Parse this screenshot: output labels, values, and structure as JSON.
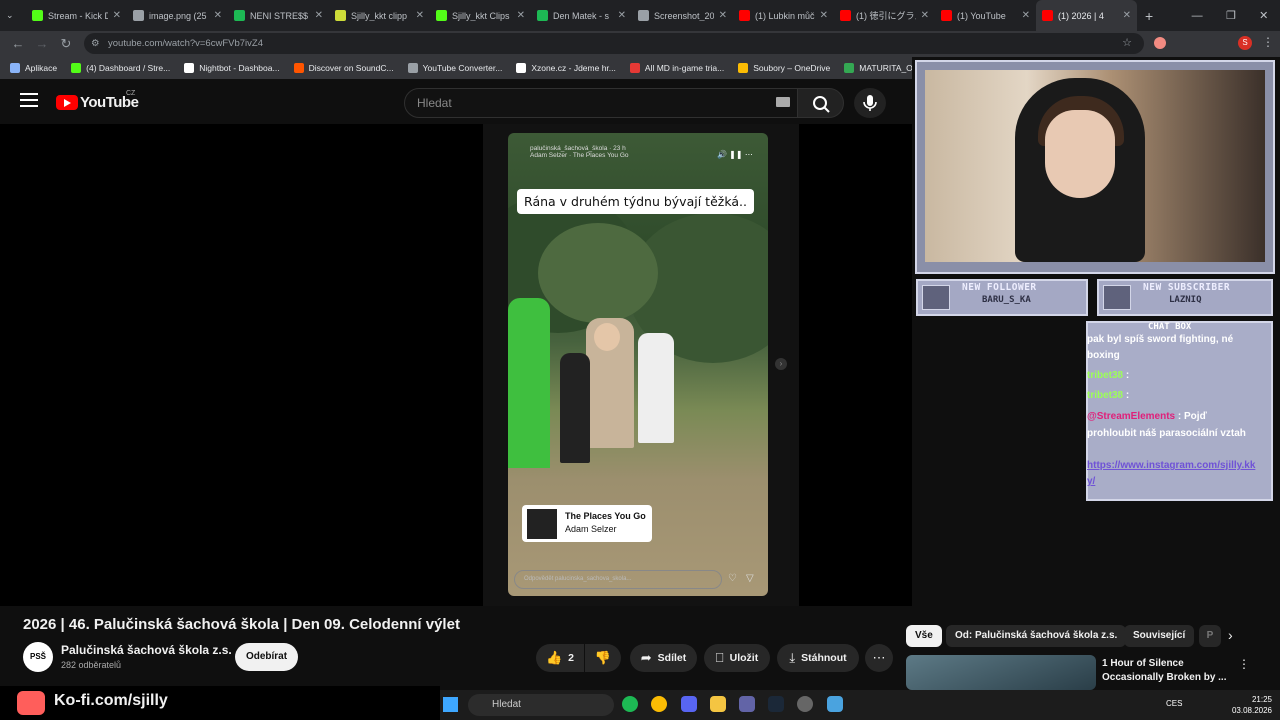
{
  "browser": {
    "tabs": [
      {
        "title": "Stream - Kick D",
        "color": "#53fc18"
      },
      {
        "title": "image.png (25",
        "color": "#9aa0a6"
      },
      {
        "title": "NENI STRE$$",
        "color": "#1db954"
      },
      {
        "title": "Sjilly_kkt clipp",
        "color": "#cddc39"
      },
      {
        "title": "Sjilly_kkt Clips",
        "color": "#53fc18"
      },
      {
        "title": "Den Matek - s",
        "color": "#1db954"
      },
      {
        "title": "Screenshot_20",
        "color": "#9aa0a6"
      },
      {
        "title": "(1) Lubkin můč",
        "color": "#ff0000"
      },
      {
        "title": "(1) 徳引にグラス",
        "color": "#ff0000"
      },
      {
        "title": "(1) YouTube",
        "color": "#ff0000"
      },
      {
        "title": "(1) 2026 | 4",
        "color": "#ff0000"
      }
    ],
    "url": "youtube.com/watch?v=6cwFVb7ivZ4",
    "bookmarks": [
      {
        "label": "Aplikace",
        "color": "#8ab4f8"
      },
      {
        "label": "(4) Dashboard / Stre...",
        "color": "#53fc18"
      },
      {
        "label": "Nightbot - Dashboa...",
        "color": "#ffffff"
      },
      {
        "label": "Discover on SoundC...",
        "color": "#ff5500"
      },
      {
        "label": "YouTube Converter...",
        "color": "#9aa0a6"
      },
      {
        "label": "Xzone.cz - Jdeme hr...",
        "color": "#ffffff"
      },
      {
        "label": "All MD in-game tria...",
        "color": "#e53935"
      },
      {
        "label": "Soubory – OneDrive",
        "color": "#fbbc04"
      },
      {
        "label": "MATURITA_OKRUH...",
        "color": "#34a853"
      }
    ]
  },
  "youtube": {
    "logo_text": "YouTube",
    "region": "CZ",
    "search_placeholder": "Hledat",
    "video": {
      "caption": "Rána v druhém týdnu bývají těžká..",
      "ig_user": "palučinská_šachová_škola · 23 h",
      "ig_song": "Adam Selzer · The Places You Go",
      "music_title": "The Places You Go",
      "music_artist": "Adam Selzer",
      "reply_placeholder": "Odpovědět palucinska_sachova_skola..."
    },
    "title": "2026 | 46. Palučinská šachová škola | Den 09. Celodenní výlet",
    "channel": {
      "name": "Palučinská šachová škola z.s.",
      "subs": "282 odběratelů",
      "avatar_text": "PSŠ"
    },
    "subscribe_label": "Odebírat",
    "actions": {
      "likes": "2",
      "share": "Sdílet",
      "save": "Uložit",
      "download": "Stáhnout"
    },
    "chips": [
      "Vše",
      "Od: Palučinská šachová škola z.s.",
      "Související",
      "P"
    ],
    "recommendation": {
      "title": "1 Hour of Silence Occasionally Broken by ..."
    }
  },
  "overlay": {
    "new_follower_label": "NEW FOLLOWER",
    "new_follower_name": "BARU_S_KA",
    "new_subscriber_label": "NEW SUBSCRIBER",
    "new_subscriber_name": "LAZNIQ",
    "chat_title": "CHAT BOX",
    "chat": [
      {
        "text": "pak byl spíš sword fighting, né"
      },
      {
        "text": "boxing"
      },
      {
        "user": "tribet38",
        "text": ":"
      },
      {
        "user": "tribet38",
        "text": ":"
      },
      {
        "user": "@StreamElements",
        "text": ": Pojď"
      },
      {
        "text": "prohloubit náš parasociální vztah"
      },
      {
        "link": "https://www.instagram.com/sjilly.kk"
      },
      {
        "link2": "y/"
      }
    ]
  },
  "kofi": "Ko-fi.com/sjilly",
  "taskbar": {
    "search": "Hledat",
    "lang": "CES",
    "time": "21:25",
    "date": "03.08.2026"
  }
}
